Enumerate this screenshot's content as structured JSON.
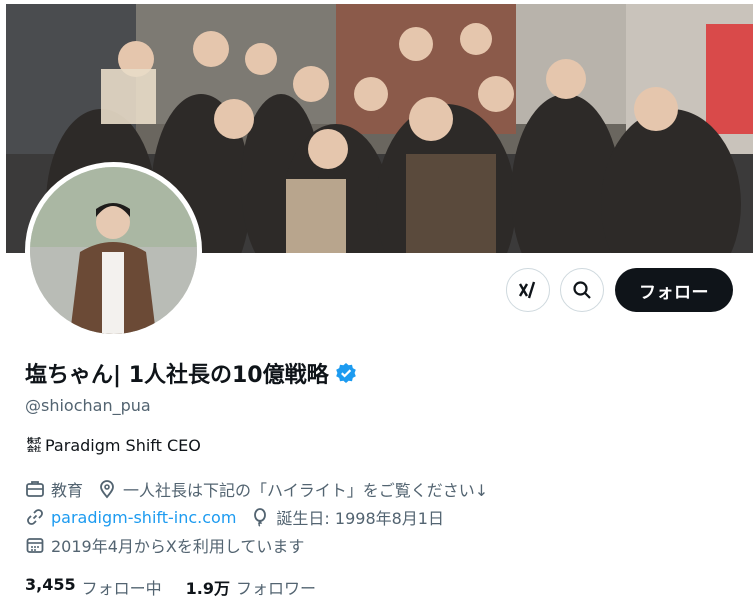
{
  "profile": {
    "name": "塩ちゃん| 1人社長の10億戦略",
    "handle": "@shiochan_pua",
    "bio_prefix": "株式会社",
    "bio_text": "Paradigm Shift CEO",
    "category": "教育",
    "location": "一人社長は下記の「ハイライト」をご覧ください↓",
    "website": "paradigm-shift-inc.com",
    "birthday": "誕生日: 1998年8月1日",
    "joined": "2019年4月からXを利用しています"
  },
  "stats": {
    "following_count": "3,455",
    "following_label": "フォロー中",
    "followers_count": "1.9万",
    "followers_label": "フォロワー"
  },
  "actions": {
    "follow_label": "フォロー",
    "grok_icon": "grok-icon",
    "search_icon": "search-icon"
  },
  "colors": {
    "accent": "#1d9bf0",
    "text": "#0f1419",
    "secondary": "#536471",
    "follow_bg": "#0f1419"
  }
}
